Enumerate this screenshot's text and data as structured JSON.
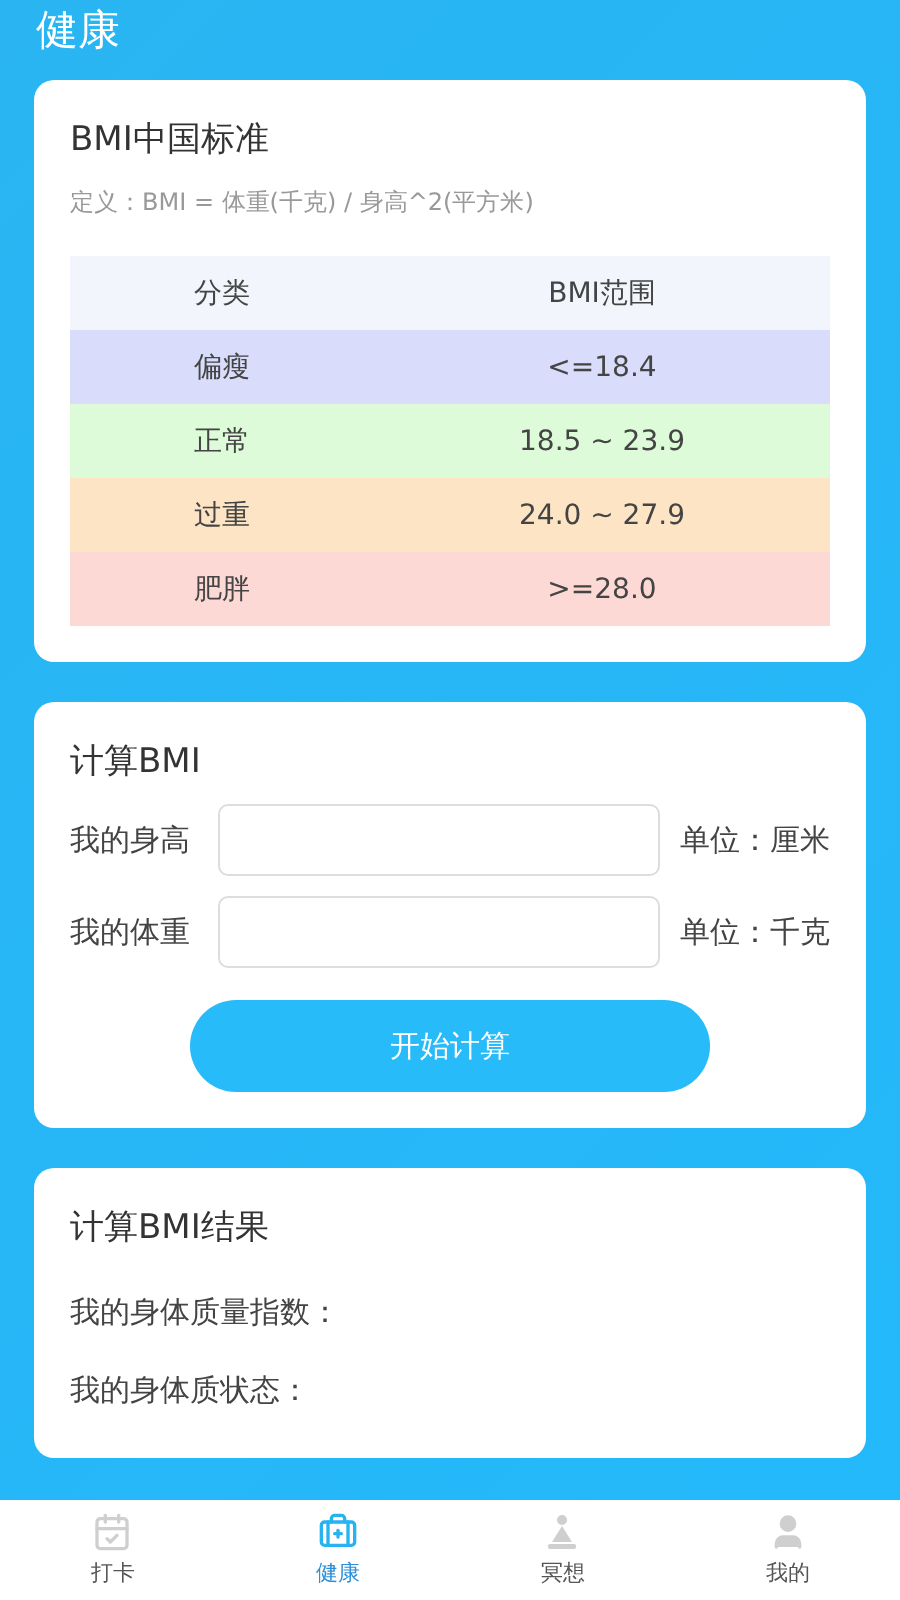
{
  "header": {
    "title": "健康"
  },
  "standard_card": {
    "title": "BMI中国标准",
    "definition": "定义：BMI = 体重(千克) / 身高^2(平方米)",
    "table": {
      "columns": [
        "分类",
        "BMI范围"
      ],
      "rows": [
        {
          "category": "偏瘦",
          "range": "<=18.4",
          "color": "#d9dcfa"
        },
        {
          "category": "正常",
          "range": "18.5 ~ 23.9",
          "color": "#ddfbd9"
        },
        {
          "category": "过重",
          "range": "24.0 ~ 27.9",
          "color": "#fde4c4"
        },
        {
          "category": "肥胖",
          "range": ">=28.0",
          "color": "#fdd9d5"
        }
      ]
    }
  },
  "calc_card": {
    "title": "计算BMI",
    "fields": [
      {
        "label": "我的身高",
        "unit": "单位：厘米"
      },
      {
        "label": "我的体重",
        "unit": "单位：千克"
      }
    ],
    "button": "开始计算"
  },
  "result_card": {
    "title": "计算BMI结果",
    "lines": [
      "我的身体质量指数：",
      "我的身体质状态："
    ]
  },
  "tab_bar": [
    {
      "label": "打卡",
      "kind": "calendar",
      "selected": false
    },
    {
      "label": "健康",
      "kind": "medkit",
      "selected": true
    },
    {
      "label": "冥想",
      "kind": "meditation",
      "selected": false
    },
    {
      "label": "我的",
      "kind": "person",
      "selected": false
    }
  ]
}
